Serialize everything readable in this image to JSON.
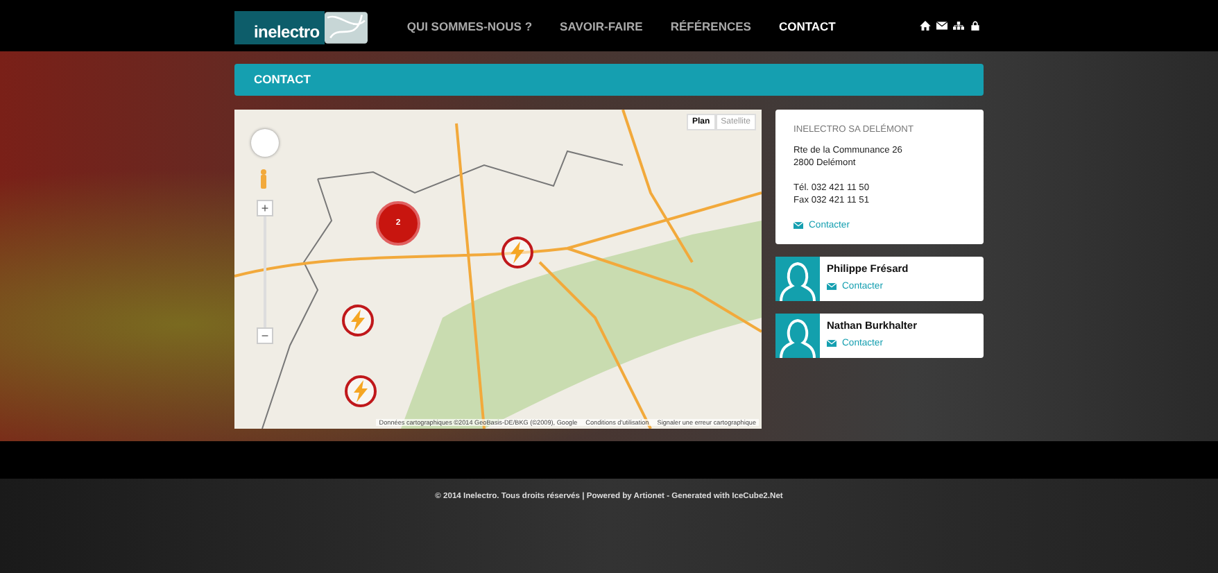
{
  "header": {
    "logo_text": "inelectro",
    "nav": [
      {
        "label": "QUI SOMMES-NOUS ?",
        "selected": false
      },
      {
        "label": "SAVOIR-FAIRE",
        "selected": false
      },
      {
        "label": "RÉFÉRENCES",
        "selected": false
      },
      {
        "label": "CONTACT",
        "selected": true
      }
    ]
  },
  "page_title": "CONTACT",
  "map": {
    "map_type_buttons": [
      {
        "label": "Plan",
        "selected": true
      },
      {
        "label": "Satellite",
        "selected": false
      }
    ],
    "zoom_in": "+",
    "zoom_out": "−",
    "markers": [
      {
        "kind": "cluster",
        "label": "2"
      },
      {
        "kind": "bolt"
      },
      {
        "kind": "bolt"
      },
      {
        "kind": "bolt"
      }
    ],
    "attribution": [
      "Données cartographiques ©2014 GeoBasis-DE/BKG (©2009), Google",
      "Conditions d'utilisation",
      "Signaler une erreur cartographique"
    ]
  },
  "office": {
    "name": "INELECTRO SA DELÉMONT",
    "address": [
      "Rte de la Communance 26",
      "2800 Delémont"
    ],
    "phones": [
      "Tél. 032 421 11 50",
      "Fax 032 421 11 51"
    ],
    "contact_link": "Contacter"
  },
  "people": [
    {
      "name": "Philippe Frésard",
      "contact_link": "Contacter"
    },
    {
      "name": "Nathan Burkhalter",
      "contact_link": "Contacter"
    }
  ],
  "footer": "© 2014 Inelectro. Tous droits réservés | Powered by Artionet - Generated with IceCube2.Net"
}
